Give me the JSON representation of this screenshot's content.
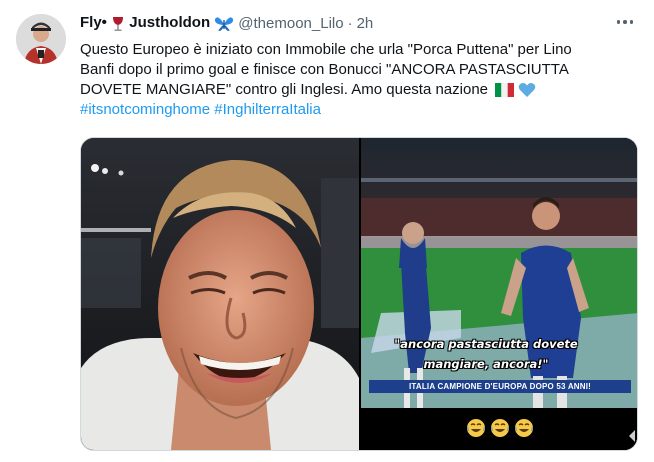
{
  "tweet": {
    "author": {
      "display_name_start": "Fly•",
      "display_name_end": "Justholdon",
      "handle": "@themoon_Lilo",
      "separator": "·",
      "time": "2h"
    },
    "text_lines": [
      "Questo Europeo è iniziato con Immobile che urla \"Porca Puttena\" per Lino",
      "Banfi dopo il primo goal e finisce con Bonucci \"ANCORA PASTASCIUTTA",
      "DOVETE MANGIARE\" contro gli Inglesi. Amo questa nazione"
    ],
    "hashtags": [
      "#itsnotcominghome",
      "#InghilterraItalia"
    ],
    "icons": {
      "name_icon_1": "wine-glass-icon",
      "name_icon_2": "blue-butterfly-icon",
      "text_icon_1": "italy-flag-icon",
      "text_icon_2": "blue-heart-icon",
      "more": "more-options-icon"
    },
    "colors": {
      "link": "#1d9bf0",
      "secondary_text": "#536471",
      "primary_text": "#0f1419",
      "butterfly": "#2f8ce6",
      "heart": "#5dade2"
    }
  },
  "media": {
    "right_video": {
      "caption_line_1": "\"ancora pastasciutta dovete",
      "caption_line_2": "mangiare, ancora!\"",
      "banner": "ITALIA CAMPIONE D'EUROPA DOPO 53 ANNI!",
      "emoji": [
        "crying-laughing-icon",
        "crying-laughing-icon",
        "crying-laughing-icon"
      ]
    }
  }
}
